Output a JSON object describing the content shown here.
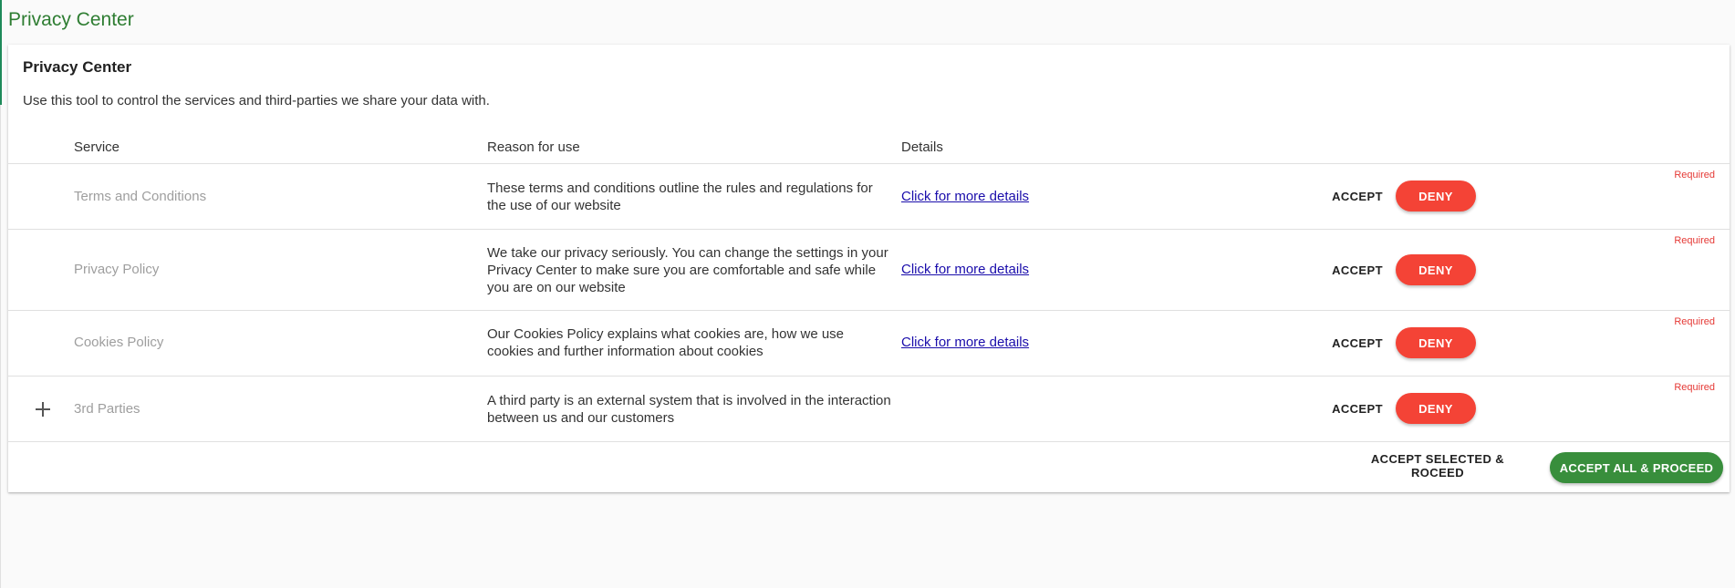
{
  "page": {
    "title": "Privacy Center"
  },
  "card": {
    "title": "Privacy Center",
    "subtitle": "Use this tool to control the services and third-parties we share your data with."
  },
  "table": {
    "headers": {
      "service": "Service",
      "reason": "Reason for use",
      "details": "Details"
    },
    "rows": [
      {
        "service": "Terms and Conditions",
        "reason": "These terms and conditions outline the rules and regulations for the use of our website",
        "details": "Click for more details",
        "accept": "ACCEPT",
        "deny": "DENY",
        "required": "Required"
      },
      {
        "service": "Privacy Policy",
        "reason": "We take our privacy seriously. You can change the settings in your Privacy Center to make sure you are comfortable and safe while you are on our website",
        "details": "Click for more details",
        "accept": "ACCEPT",
        "deny": "DENY",
        "required": "Required"
      },
      {
        "service": "Cookies Policy",
        "reason": "Our Cookies Policy explains what cookies are, how we use cookies and further information about cookies",
        "details": "Click for more details",
        "accept": "ACCEPT",
        "deny": "DENY",
        "required": "Required"
      },
      {
        "service": "3rd Parties",
        "reason": "A third party is an external system that is involved in the interaction between us and our customers",
        "details": "",
        "accept": "ACCEPT",
        "deny": "DENY",
        "required": "Required",
        "expand_icon": "plus-icon"
      }
    ]
  },
  "footer": {
    "accept_selected": "ACCEPT SELECTED & ROCEED",
    "accept_all": "ACCEPT ALL & PROCEED"
  },
  "colors": {
    "brand_green": "#2e7d32",
    "accept_all_green": "#388e3c",
    "deny_red": "#f44336",
    "required_red": "#e53935",
    "link_blue": "#1a0dab"
  }
}
